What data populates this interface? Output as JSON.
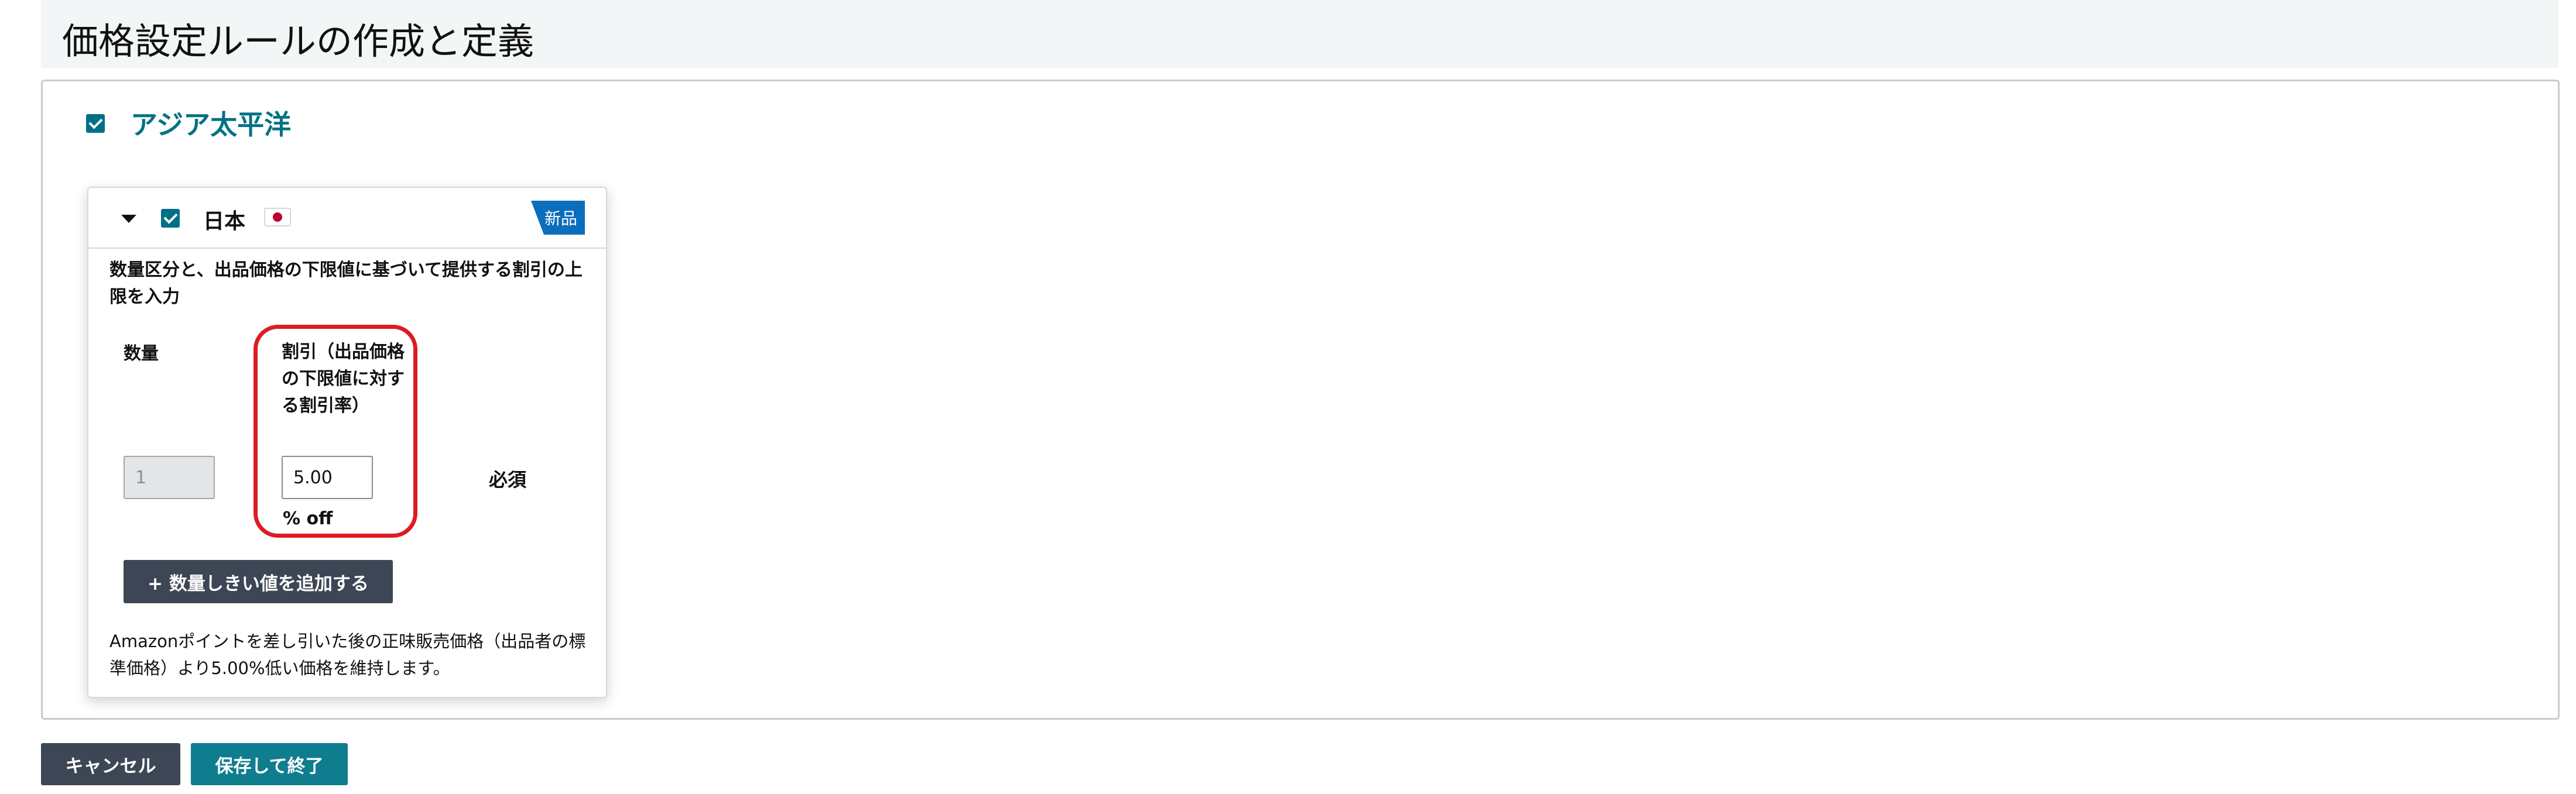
{
  "page": {
    "title": "価格設定ルールの作成と定義"
  },
  "region": {
    "label": "アジア太平洋",
    "checked": true
  },
  "country": {
    "name": "日本",
    "checked": true,
    "expanded": true,
    "flag_icon": "japan-flag-icon",
    "badge": "新品",
    "description": "数量区分と、出品価格の下限値に基づいて提供する割引の上限を入力",
    "table": {
      "quantity_header": "数量",
      "discount_header": "割引（出品価格の下限値に対する割引率）",
      "rows": [
        {
          "quantity": "1",
          "discount": "5.00",
          "suffix": "% off",
          "required_label": "必須"
        }
      ]
    },
    "add_threshold_label": "+ 数量しきい値を追加する",
    "note": "Amazonポイントを差し引いた後の正味販売価格（出品者の標準価格）より5.00%低い価格を維持します。"
  },
  "actions": {
    "cancel_label": "キャンセル",
    "save_label": "保存して終了"
  },
  "colors": {
    "accent": "#007185",
    "badge": "#0a6ebd",
    "dark_button": "#3d4654",
    "save_button": "#107d8f",
    "highlight": "#dd1c24"
  }
}
